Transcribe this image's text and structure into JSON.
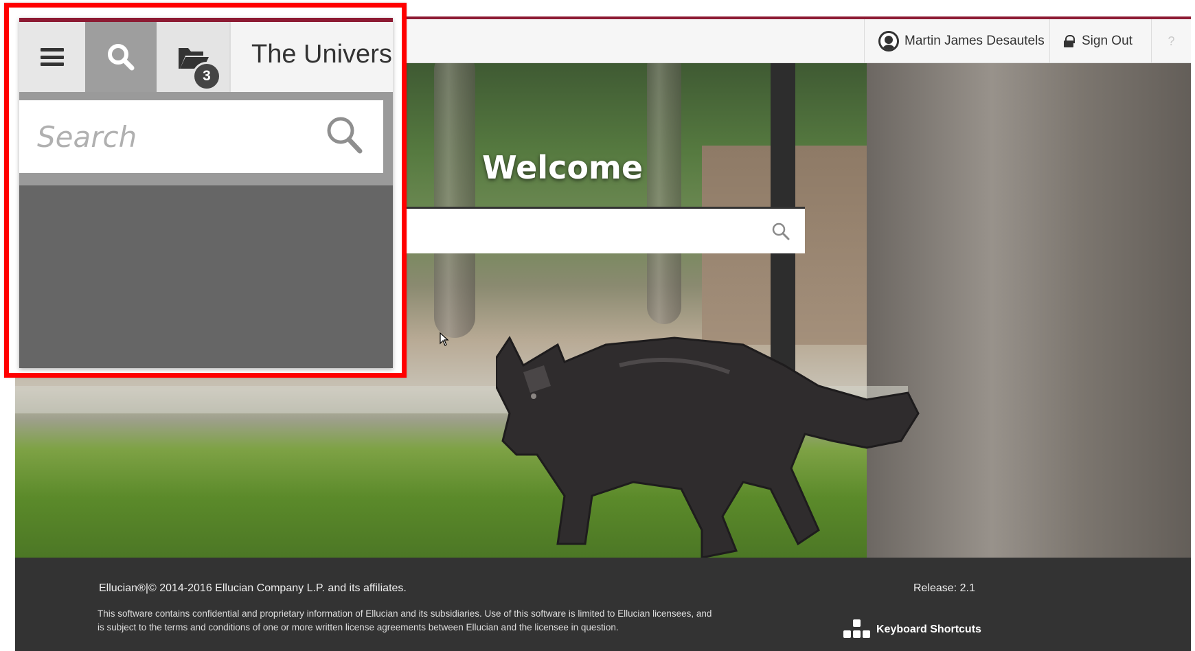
{
  "header": {
    "user_name": "Martin James Desautels",
    "sign_out_label": "Sign Out",
    "help_label": "?"
  },
  "welcome": {
    "title": "Welcome",
    "search_placeholder": ""
  },
  "callout": {
    "brand_title": "The Univers",
    "recent_count": "3",
    "search_placeholder": "Search"
  },
  "footer": {
    "copyright": "Ellucian®|© 2014-2016 Ellucian Company L.P. and its affiliates.",
    "disclaimer": "This software contains confidential and proprietary information of Ellucian and its subsidiaries. Use of this software is limited to Ellucian licensees, and is subject to the terms and conditions of one or more written license agreements between Ellucian and the licensee in question.",
    "release": "Release: 2.1",
    "keyboard_shortcuts_label": "Keyboard Shortcuts"
  },
  "colors": {
    "brand_maroon": "#8d1b33",
    "callout_border": "#ff0000",
    "footer_bg": "#333333"
  },
  "icons": {
    "user": "user-avatar-icon",
    "sign_out": "lock-icon",
    "search": "search-icon",
    "menu": "hamburger-menu-icon",
    "recent": "folder-open-icon",
    "keyboard": "keyboard-keys-icon"
  }
}
